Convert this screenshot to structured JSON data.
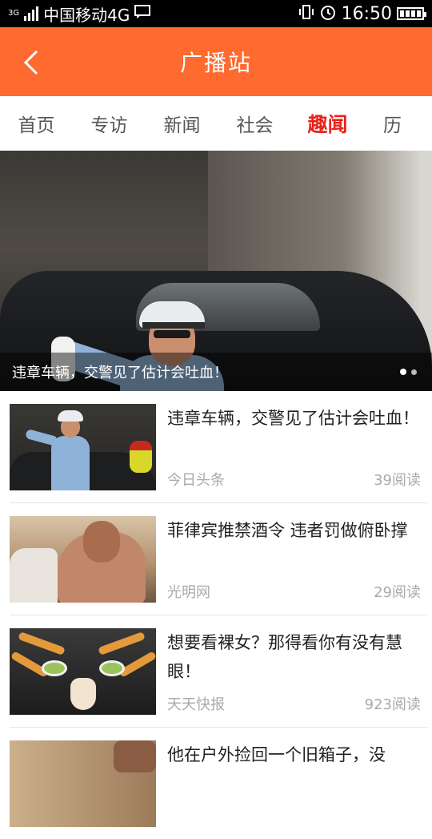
{
  "status_bar": {
    "carrier": "中国移动4G",
    "network_label": "3G",
    "time": "16:50"
  },
  "header": {
    "title": "广播站",
    "back_icon": "chevron-left-icon"
  },
  "tabs": [
    {
      "label": "首页",
      "active": false
    },
    {
      "label": "专访",
      "active": false
    },
    {
      "label": "新闻",
      "active": false
    },
    {
      "label": "社会",
      "active": false
    },
    {
      "label": "趣闻",
      "active": true
    },
    {
      "label": "历",
      "active": false
    }
  ],
  "banner": {
    "caption": "违章车辆，交警见了估计会吐血！",
    "page_count": 2,
    "active_page": 1
  },
  "news": [
    {
      "title": "违章车辆，交警见了估计会吐血！",
      "source": "今日头条",
      "reads": "39阅读"
    },
    {
      "title": "菲律宾推禁酒令 违者罚做俯卧撑",
      "source": "光明网",
      "reads": "29阅读"
    },
    {
      "title": "想要看裸女？那得看你有没有慧眼！",
      "source": "天天快报",
      "reads": "923阅读"
    },
    {
      "title": "他在户外捡回一个旧箱子，没",
      "source": "",
      "reads": ""
    }
  ],
  "colors": {
    "accent": "#ff6a2f",
    "active_tab": "#e8231a"
  }
}
